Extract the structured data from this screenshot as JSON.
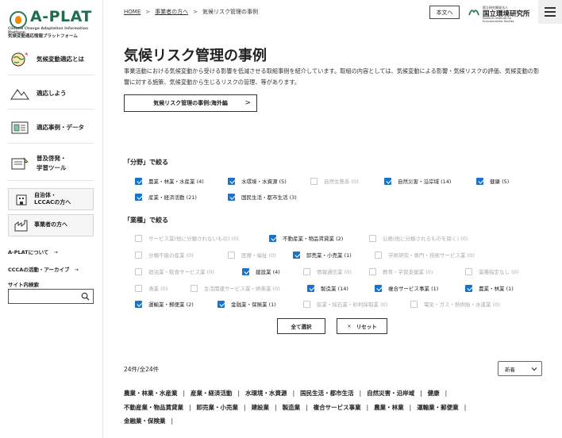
{
  "logo": {
    "name": "A-PLAT",
    "subtitle_en": "Climate Change Adaptation Information Platform",
    "subtitle_ja": "気候変動適応情報プラットフォーム"
  },
  "sidebar": {
    "items": [
      {
        "label": "気候変動適応とは",
        "icon": "globe-icon"
      },
      {
        "label": "適応しよう",
        "icon": "mountain-icon"
      },
      {
        "label": "適応事例・データ",
        "icon": "data-icon"
      },
      {
        "label_line1": "普及啓発・",
        "label_line2": "学習ツール",
        "icon": "book-icon"
      }
    ],
    "boxes": [
      {
        "label_line1": "自治体・",
        "label_line2": "LCCACの方へ",
        "icon": "building-icon"
      },
      {
        "label": "事業者の方へ",
        "icon": "factory-icon"
      }
    ],
    "links": [
      {
        "label": "A-PLATについて",
        "arrow": "→"
      },
      {
        "label": "CCCAの活動・アーカイブ",
        "arrow": "→"
      }
    ],
    "search_label": "サイト内検索",
    "search_placeholder": ""
  },
  "header": {
    "breadcrumb": [
      "HOME",
      "事業者の方へ",
      "気候リスク管理の事例"
    ],
    "breadcrumb_sep": ">",
    "honbun_button": "本文へ",
    "nies_line1": "国立研究開発法人",
    "nies_name": "国立環境研究所",
    "nies_line3": "National Institute for Environmental Studies"
  },
  "main": {
    "title": "気候リスク管理の事例",
    "intro": "事業活動における気候変動から受ける影響を低減させる取組事例を紹介しています。取組の内容としては、気候変動による影響・気候リスクの評価、気候変動の影響に対する施策、気候変動から生じるリスクの管理、等があります。",
    "overseas_button": "気候リスク管理の事例:海外編",
    "overseas_chevron": ">",
    "field_filter": {
      "heading": "「分野」で絞る",
      "options": [
        {
          "label": "農業・林業・水産業 (4)",
          "checked": true,
          "disabled": false
        },
        {
          "label": "水環境・水資源 (5)",
          "checked": true,
          "disabled": false
        },
        {
          "label": "自然生態系 (0)",
          "checked": false,
          "disabled": true
        },
        {
          "label": "自然災害・沿岸域 (14)",
          "checked": true,
          "disabled": false
        },
        {
          "label": "健康 (5)",
          "checked": true,
          "disabled": false
        },
        {
          "label": "産業・経済活動 (21)",
          "checked": true,
          "disabled": false
        },
        {
          "label": "国民生活・都市生活 (3)",
          "checked": true,
          "disabled": false
        }
      ]
    },
    "industry_filter": {
      "heading": "「業種」で絞る",
      "options": [
        {
          "label": "サービス業(他に分類されないもの) (0)",
          "checked": false,
          "disabled": true
        },
        {
          "label": "不動産業・物品賃貸業 (2)",
          "checked": true,
          "disabled": false
        },
        {
          "label": "公務(他に分類されるものを除く) (0)",
          "checked": false,
          "disabled": true
        },
        {
          "label": "分類不能の産業 (0)",
          "checked": false,
          "disabled": true
        },
        {
          "label": "医療・福祉 (0)",
          "checked": false,
          "disabled": true
        },
        {
          "label": "卸売業・小売業 (1)",
          "checked": true,
          "disabled": false
        },
        {
          "label": "学術研究・専門・技術サービス業 (0)",
          "checked": false,
          "disabled": true
        },
        {
          "label": "宿泊業・飲食サービス業 (0)",
          "checked": false,
          "disabled": true
        },
        {
          "label": "建設業 (4)",
          "checked": true,
          "disabled": false
        },
        {
          "label": "情報通信業 (0)",
          "checked": false,
          "disabled": true
        },
        {
          "label": "教育・学習支援業 (0)",
          "checked": false,
          "disabled": true
        },
        {
          "label": "業種指定なし (0)",
          "checked": false,
          "disabled": true
        },
        {
          "label": "漁業 (0)",
          "checked": false,
          "disabled": true
        },
        {
          "label": "生活関連サービス業・娯楽業 (0)",
          "checked": false,
          "disabled": true
        },
        {
          "label": "製造業 (14)",
          "checked": true,
          "disabled": false
        },
        {
          "label": "複合サービス事業 (1)",
          "checked": true,
          "disabled": false
        },
        {
          "label": "農業・林業 (1)",
          "checked": true,
          "disabled": false
        },
        {
          "label": "運輸業・郵便業 (2)",
          "checked": true,
          "disabled": false
        },
        {
          "label": "金融業・保険業 (1)",
          "checked": true,
          "disabled": false
        },
        {
          "label": "鉱業・採石業・砂利採取業 (0)",
          "checked": false,
          "disabled": true
        },
        {
          "label": "電気・ガス・熱供給・水道業 (0)",
          "checked": false,
          "disabled": true
        }
      ]
    },
    "select_all_button": "全て選択",
    "reset_button": "リセット",
    "reset_icon": "×",
    "result_count": "24件/全24件",
    "sort": {
      "selected": "新着"
    },
    "category_links": [
      "農業・林業・水産業",
      "産業・経済活動",
      "水環境・水資源",
      "国民生活・都市生活",
      "自然災害・沿岸域",
      "健康",
      "不動産業・物品賃貸業",
      "卸売業・小売業",
      "建設業",
      "製造業",
      "複合サービス事業",
      "農業・林業",
      "運輸業・郵便業",
      "金融業・保険業"
    ],
    "category_sep": "|"
  },
  "colors": {
    "accent_check": "#1a73c9",
    "logo_green": "#1e6e4c",
    "logo_orange": "#f08a00"
  }
}
